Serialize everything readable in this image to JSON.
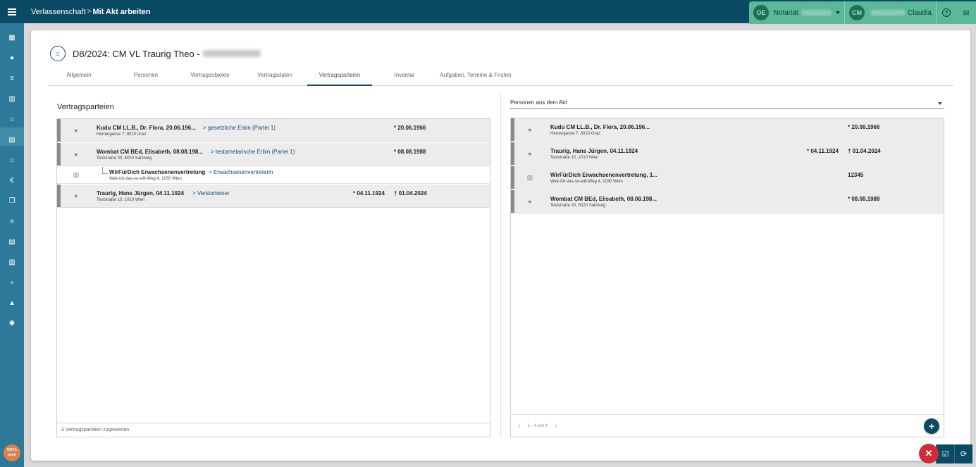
{
  "topbar": {
    "breadcrumb_parent": "Verlassenschaft",
    "breadcrumb_sep": ">",
    "breadcrumb_current": "Mit Akt arbeiten",
    "office_initials": "OE",
    "office_name": "Notariat",
    "user_initials": "CM",
    "user_name": "Claudia",
    "help_icon": "help-circle-icon",
    "messages_icon": "mail-icon"
  },
  "sidebar": {
    "items": [
      {
        "icon": "calendar-icon",
        "glyph": "▦"
      },
      {
        "icon": "person-icon",
        "glyph": "●"
      },
      {
        "icon": "list-icon",
        "glyph": "≡"
      },
      {
        "icon": "books-icon",
        "glyph": "▥"
      },
      {
        "icon": "estate-icon",
        "glyph": "⌂"
      },
      {
        "icon": "document-icon",
        "glyph": "▤"
      },
      {
        "icon": "bank-icon",
        "glyph": "⌂"
      },
      {
        "icon": "euro-icon",
        "glyph": "€"
      },
      {
        "icon": "copy-icon",
        "glyph": "❐"
      },
      {
        "icon": "grid-icon",
        "glyph": "■"
      },
      {
        "icon": "file-icon",
        "glyph": "▤"
      },
      {
        "icon": "register-icon",
        "glyph": "▥"
      },
      {
        "icon": "info-icon",
        "glyph": "●"
      },
      {
        "icon": "stats-icon",
        "glyph": "▲"
      },
      {
        "icon": "settings-icon",
        "glyph": "✱"
      }
    ],
    "logo_line1": "NOTA",
    "logo_line2": "work"
  },
  "header": {
    "title": "D8/2024: CM VL Traurig Theo -"
  },
  "tabs": [
    {
      "label": "Allgemein"
    },
    {
      "label": "Personen"
    },
    {
      "label": "Vertragsobjekte"
    },
    {
      "label": "Vertragsdaten"
    },
    {
      "label": "Vertragsparteien"
    },
    {
      "label": "Inventar"
    },
    {
      "label": "Aufgaben, Termine & Fristen"
    }
  ],
  "left": {
    "title": "Vertragsparteien",
    "rows": [
      {
        "name": "Kudu CM LL.B., Dr. Flora, 20.06.196...",
        "addr": "Herrengasse 7, 8010 Graz",
        "role": "> gesetzliche Erbin (Partei 1)",
        "d1": "* 20.06.1966",
        "d2": ""
      },
      {
        "name": "Wombat CM BEd, Elisabeth, 08.08.198...",
        "addr": "Teststraße 30, 5020 Salzburg",
        "role": "> testametarische Erbin (Partei 1)",
        "d1": "* 08.08.1988",
        "d2": ""
      },
      {
        "name": "WirFürDich Erwachsenenvertretung",
        "addr": "Weil-ich-das-so-will-Weg 4, 1030 Wien",
        "role": "> Erwachsenenvertreterin",
        "d1": "",
        "d2": ""
      },
      {
        "name": "Traurig, Hans Jürgen, 04.11.1924",
        "addr": "Teststraße 10, 1010 Wien",
        "role": "> Verstorbener",
        "d1": "* 04.11.1924",
        "d2": "† 01.04.2024"
      }
    ],
    "footer": "3 Vertragsparteien zugewiesen"
  },
  "right": {
    "select_value": "Personen aus dem Akt",
    "rows": [
      {
        "name": "Kudu CM LL.B., Dr. Flora, 20.06.196...",
        "addr": "Herrengasse 7, 8010 Graz",
        "d1": "",
        "d2": "* 20.06.1966"
      },
      {
        "name": "Traurig, Hans Jürgen, 04.11.1924",
        "addr": "Teststraße 10, 1010 Wien",
        "d1": "* 04.11.1924",
        "d2": "† 01.04.2024"
      },
      {
        "name": "WirFürDich Erwachsenenvertretung, 1...",
        "addr": "Weil-ich-das-so-will-Weg 4, 1030 Wien",
        "d1": "",
        "d2": "12345"
      },
      {
        "name": "Wombat CM BEd, Elisabeth, 08.08.198...",
        "addr": "Teststraße 30, 5020 Salzburg",
        "d1": "",
        "d2": "* 08.08.1988"
      }
    ],
    "pager_text": "1 - 4 von 4",
    "add_label": "+"
  },
  "actions": {
    "close_label": "✕",
    "save_icon": "check-document-icon",
    "sync_icon": "sync-icon"
  },
  "colors": {
    "topbar": "#0a4a62",
    "sidebar": "#2d7a98",
    "user_area": "#5bb89a",
    "close": "#d22b3a"
  }
}
